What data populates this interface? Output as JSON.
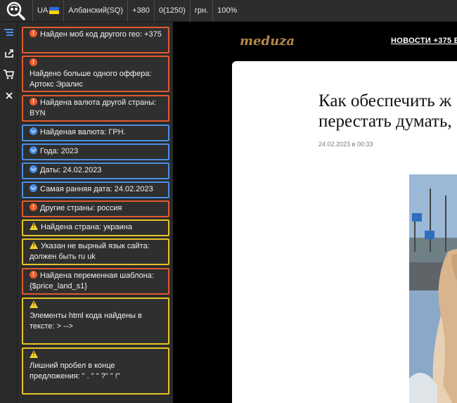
{
  "toolbar": {
    "country": "UA",
    "language": "Албанский(SQ)",
    "phone_code": "+380",
    "counter": "0(1250)",
    "currency": "грн.",
    "zoom": "100%"
  },
  "messages": [
    {
      "type": "error",
      "text": "Найден моб код другого гео: +375"
    },
    {
      "type": "error",
      "text": "Найдено больше одного оффера: Артокс Эралис"
    },
    {
      "type": "error",
      "text": "Найдена валюта другой страны: BYN"
    },
    {
      "type": "info",
      "text": "Найденая валюта: ГРН."
    },
    {
      "type": "info",
      "text": "Года: 2023"
    },
    {
      "type": "info",
      "text": "Даты: 24.02.2023"
    },
    {
      "type": "info",
      "text": "Самая ранняя дата: 24.02.2023"
    },
    {
      "type": "error",
      "text": "Другие страны: россия"
    },
    {
      "type": "warning",
      "text": "Найдена страна: украина"
    },
    {
      "type": "warning",
      "text": "Указан не вырный язык сайта: должен быть ru uk"
    },
    {
      "type": "error",
      "text": "Найдена переменная шаблона: {$price_land_s1}"
    },
    {
      "type": "warning",
      "text": "Элементы html кода найдены в тексте: > -->"
    },
    {
      "type": "warning",
      "text": "Лишний пробел в конце предложения: \" . \" \" ?\" \" !\""
    }
  ],
  "page": {
    "brand": "meduza",
    "nav_link": "НОВОСТИ +375 БЕ",
    "headline_line1": "Как обеспечить ж",
    "headline_line2": "перестать думать,",
    "date": "24.02.2023 в 00:33"
  },
  "colors": {
    "error": "#e15a2e",
    "info": "#4a8fe4",
    "warning": "#e6c52a"
  }
}
